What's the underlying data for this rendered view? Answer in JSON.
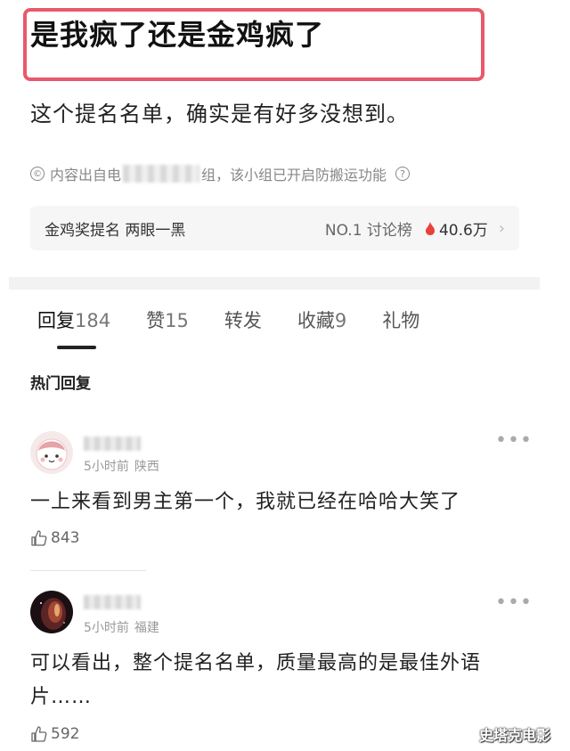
{
  "post": {
    "title": "是我疯了还是金鸡疯了",
    "subtitle": "这个提名名单，确实是有好多没想到。",
    "source_prefix": "内容出自电",
    "source_suffix": "组，该小组已开启防搬运功能",
    "highlight_color": "#e8596a"
  },
  "topic": {
    "name": "金鸡奖提名 两眼一黑",
    "rank": "NO.1 讨论榜",
    "hot_count": "40.6万",
    "hot_color": "#e8413a"
  },
  "tabs": [
    {
      "label": "回复",
      "count": "184"
    },
    {
      "label": "赞",
      "count": "15"
    },
    {
      "label": "转发",
      "count": ""
    },
    {
      "label": "收藏",
      "count": "9"
    },
    {
      "label": "礼物",
      "count": ""
    }
  ],
  "section_title": "热门回复",
  "comments": [
    {
      "time": "5小时前",
      "location": "陕西",
      "text": "一上来看到男主第一个，我就已经在哈哈大笑了",
      "likes": "843"
    },
    {
      "time": "5小时前",
      "location": "福建",
      "text": "可以看出，整个提名名单，质量最高的是最佳外语片……",
      "likes": "592"
    }
  ],
  "watermark": "史塔克电影"
}
